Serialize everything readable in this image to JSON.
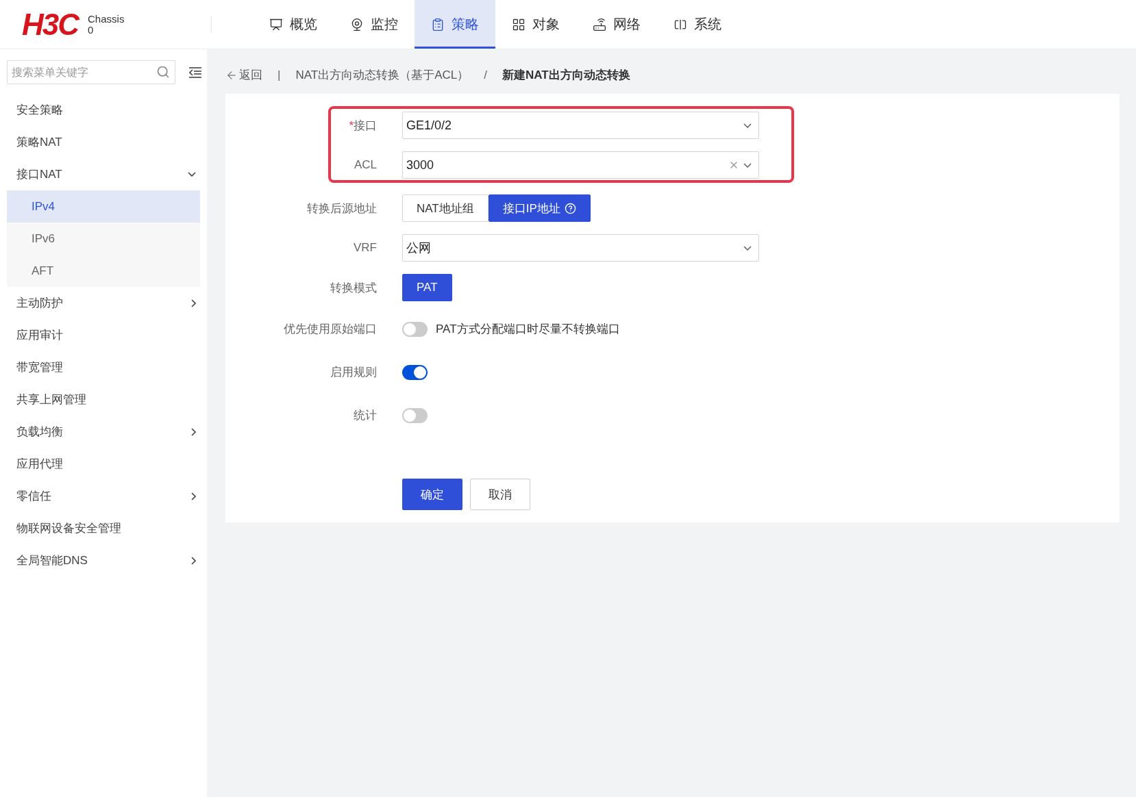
{
  "header": {
    "logo": "H3C",
    "chassis_label": "Chassis",
    "chassis_value": "0"
  },
  "nav_tabs": [
    {
      "label": "概览",
      "selected": false
    },
    {
      "label": "监控",
      "selected": false
    },
    {
      "label": "策略",
      "selected": true
    },
    {
      "label": "对象",
      "selected": false
    },
    {
      "label": "网络",
      "selected": false
    },
    {
      "label": "系统",
      "selected": false
    }
  ],
  "sidebar": {
    "search": {
      "placeholder": "搜索菜单关键字"
    },
    "items": [
      {
        "label": "安全策略",
        "kind": "link"
      },
      {
        "label": "策略NAT",
        "kind": "link"
      },
      {
        "label": "接口NAT",
        "kind": "group",
        "expanded": true,
        "children": [
          {
            "label": "IPv4",
            "selected": true
          },
          {
            "label": "IPv6",
            "selected": false
          },
          {
            "label": "AFT",
            "selected": false
          }
        ]
      },
      {
        "label": "主动防护",
        "kind": "group",
        "expanded": false
      },
      {
        "label": "应用审计",
        "kind": "link"
      },
      {
        "label": "带宽管理",
        "kind": "link"
      },
      {
        "label": "共享上网管理",
        "kind": "link"
      },
      {
        "label": "负载均衡",
        "kind": "group",
        "expanded": false
      },
      {
        "label": "应用代理",
        "kind": "link"
      },
      {
        "label": "零信任",
        "kind": "group",
        "expanded": false
      },
      {
        "label": "物联网设备安全管理",
        "kind": "link"
      },
      {
        "label": "全局智能DNS",
        "kind": "group",
        "expanded": false
      }
    ]
  },
  "breadcrumb": {
    "back": "返回",
    "back_separator": "|",
    "items": [
      {
        "label": "NAT出方向动态转换（基于ACL）"
      },
      {
        "separator": "/",
        "label": "新建NAT出方向动态转换"
      }
    ]
  },
  "form": {
    "rows": [
      {
        "label": "接口",
        "required_mark": "*",
        "highlighted": true,
        "kind": "select",
        "value": "GE1/0/2",
        "clearable": false
      },
      {
        "label": "ACL",
        "highlighted": true,
        "kind": "select",
        "value": "3000",
        "clearable": true
      },
      {
        "label": "转换后源地址",
        "highlighted": false,
        "kind": "segmented",
        "options": [
          {
            "label": "NAT地址组",
            "selected": false,
            "help": false
          },
          {
            "label": "接口IP地址",
            "selected": true,
            "help": true
          }
        ]
      },
      {
        "label": "VRF",
        "highlighted": false,
        "kind": "select",
        "value": "公网",
        "clearable": false
      },
      {
        "label": "转换模式",
        "highlighted": false,
        "kind": "segmented",
        "options": [
          {
            "label": "PAT",
            "selected": true,
            "help": false
          }
        ]
      },
      {
        "label": "优先使用原始端口",
        "highlighted": false,
        "kind": "switch",
        "on": false,
        "description": "PAT方式分配端口时尽量不转换端口"
      },
      {
        "label": "启用规则",
        "highlighted": false,
        "kind": "switch",
        "on": true
      },
      {
        "label": "统计",
        "highlighted": false,
        "kind": "switch",
        "on": false
      }
    ],
    "buttons": [
      {
        "label": "确定",
        "kind": "primary"
      },
      {
        "label": "取消",
        "kind": "default"
      }
    ]
  }
}
